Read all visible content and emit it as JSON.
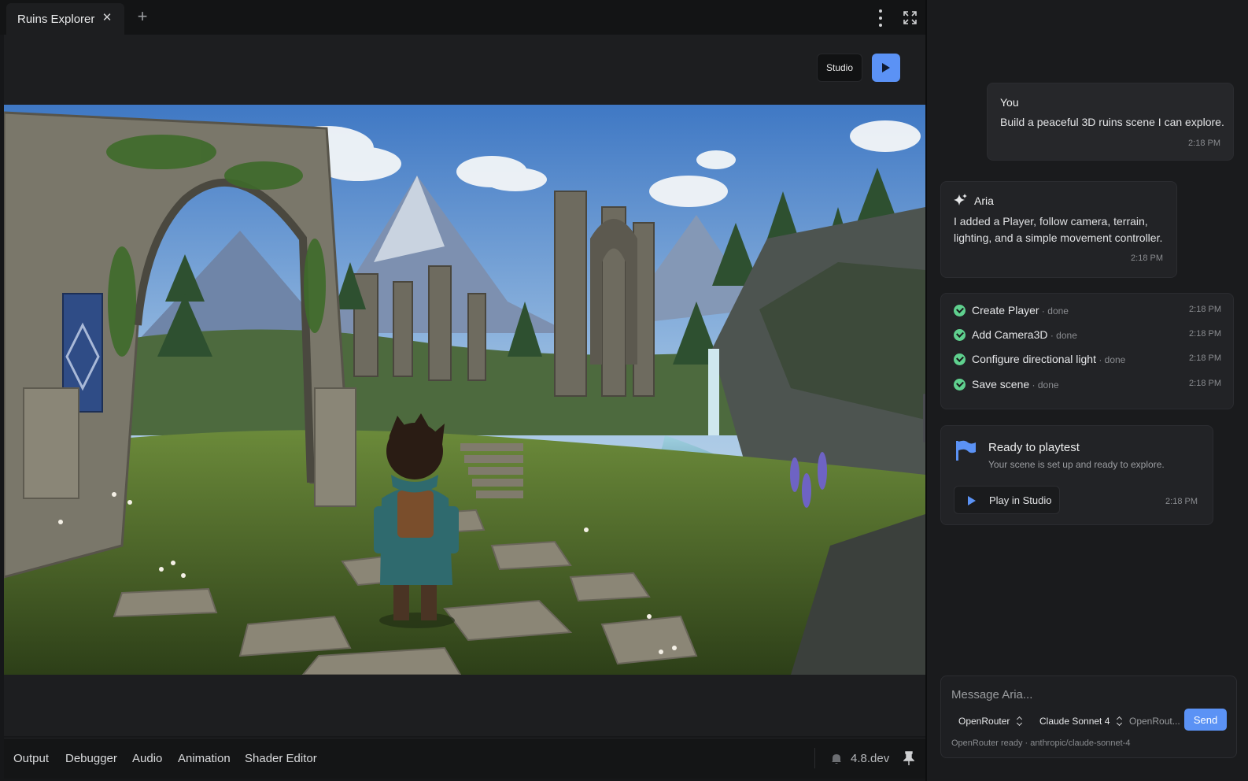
{
  "tabbar": {
    "tab_title": "Ruins Explorer",
    "new_tab_icon": "plus-icon",
    "menu_icon": "kebab-menu-icon",
    "fullscreen_icon": "fullscreen-icon"
  },
  "toolbar": {
    "studio_label": "Studio",
    "play_icon": "play-icon"
  },
  "bottom_bar": {
    "tabs": [
      "Output",
      "Debugger",
      "Audio",
      "Animation",
      "Shader Editor"
    ],
    "version": "4.8.dev",
    "notification_icon": "bell-icon",
    "pin_icon": "pin-icon"
  },
  "chat": {
    "user_message": {
      "author": "You",
      "text": "Build a peaceful 3D ruins scene I can explore.",
      "time": "2:18 PM"
    },
    "assistant_message": {
      "author": "Aria",
      "text": "I added a Player, follow camera, terrain, lighting, and a simple movement controller.",
      "time": "2:18 PM"
    },
    "tasks": [
      {
        "name": "Create Player",
        "status": "done",
        "time": "2:18 PM"
      },
      {
        "name": "Add Camera3D",
        "status": "done",
        "time": "2:18 PM"
      },
      {
        "name": "Configure directional light",
        "status": "done",
        "time": "2:18 PM"
      },
      {
        "name": "Save scene",
        "status": "done",
        "time": "2:18 PM"
      }
    ],
    "ready": {
      "title": "Ready to playtest",
      "subtitle": "Your scene is set up and ready to explore.",
      "button_label": "Play in Studio",
      "time": "2:18 PM"
    },
    "composer": {
      "placeholder": "Message Aria...",
      "provider": "OpenRouter",
      "model": "Claude Sonnet 4",
      "key_field": "OpenRout...",
      "send_label": "Send",
      "status": "OpenRouter ready · anthropic/claude-sonnet-4"
    }
  },
  "colors": {
    "accent": "#5b92f5",
    "success": "#5fd08e",
    "panel": "#1a1b1d"
  }
}
